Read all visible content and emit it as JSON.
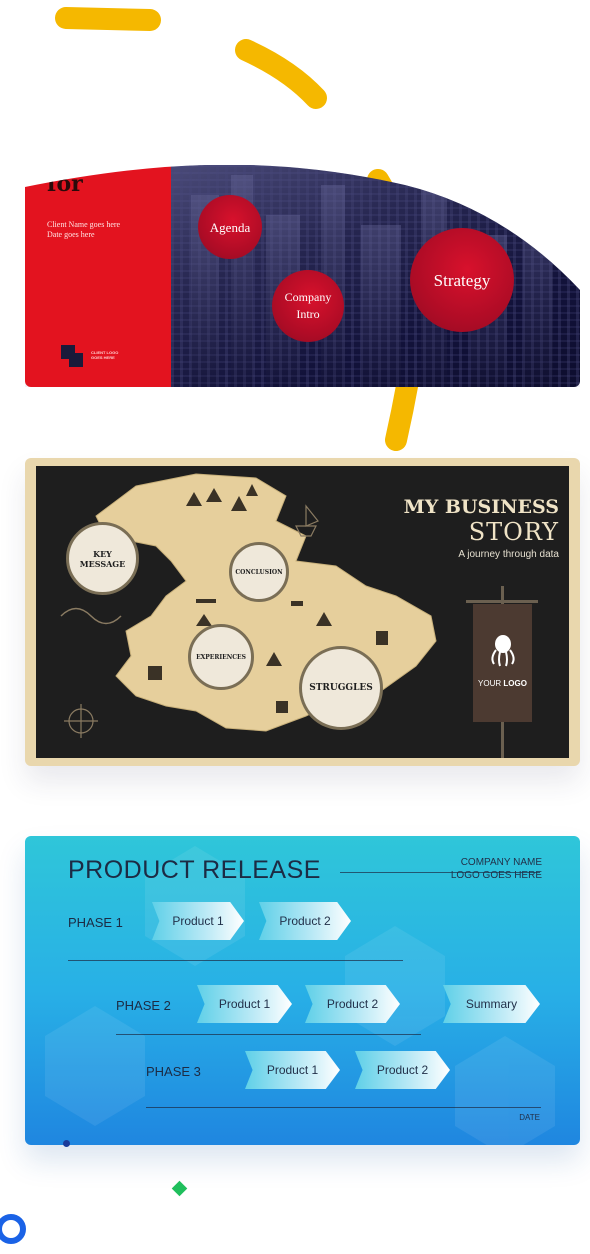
{
  "card1": {
    "cover_title_fragment": "for",
    "client_name": "Client Name goes here",
    "date": "Date goes here",
    "logo_text_line1": "CLIENT LOGO",
    "logo_text_line2": "GOES HERE",
    "bubbles": {
      "agenda": "Agenda",
      "company_intro_line1": "Company",
      "company_intro_line2": "Intro",
      "strategy": "Strategy"
    }
  },
  "card2": {
    "title_line1": "MY BUSINESS",
    "title_line2": "STORY",
    "subtitle": "A journey through data",
    "circles": {
      "key_message_line1": "KEY",
      "key_message_line2": "MESSAGE",
      "conclusion": "CONCLUSION",
      "experiences": "EXPERIENCES",
      "struggles": "STRUGGLES"
    },
    "banner_logo_prefix": "YOUR",
    "banner_logo_bold": "LOGO"
  },
  "card3": {
    "title": "PRODUCT RELEASE",
    "company_name": "COMPANY NAME",
    "logo_goes_here": "LOGO GOES HERE",
    "phase1": {
      "label": "PHASE 1",
      "items": [
        "Product 1",
        "Product 2"
      ]
    },
    "phase2": {
      "label": "PHASE 2",
      "items": [
        "Product 1",
        "Product 2",
        "Summary"
      ]
    },
    "phase3": {
      "label": "PHASE 3",
      "items": [
        "Product 1",
        "Product 2"
      ]
    },
    "date": "DATE"
  },
  "colors": {
    "accent_yellow": "#f5b800",
    "card1_red": "#e3131f",
    "card1_navy": "#12123a",
    "card2_tan": "#e9d7ad",
    "card3_blue": "#28b0e6",
    "green_diamond": "#1fbf5c",
    "blue_ring": "#1a62e6"
  }
}
